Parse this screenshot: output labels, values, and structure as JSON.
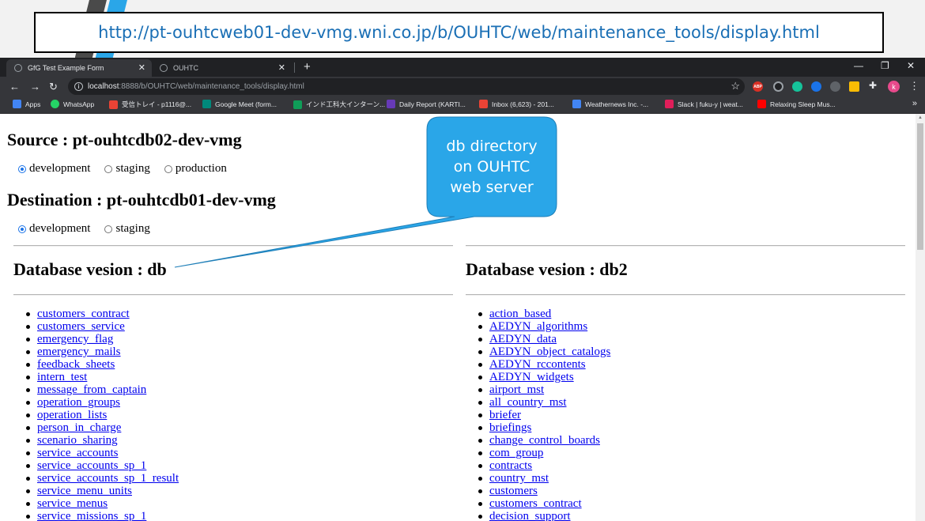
{
  "slide": {
    "url_caption": "http://pt-ouhtcweb01-dev-vmg.wni.co.jp/b/OUHTC/web/maintenance_tools/display.html",
    "callout_text": [
      "db directory",
      "on OUHTC",
      "web server"
    ]
  },
  "browser": {
    "tabs": [
      {
        "label": "GfG Test Example Form",
        "active": true
      },
      {
        "label": "OUHTC",
        "active": false
      }
    ],
    "address": {
      "host": "localhost",
      "path": ":8888/b/OUHTC/web/maintenance_tools/display.html"
    },
    "bookmarks": [
      {
        "label": "Apps",
        "icon": "apps-grid-icon",
        "color": "#4285f4"
      },
      {
        "label": "WhatsApp",
        "icon": "whatsapp-icon",
        "color": "#25d366"
      },
      {
        "label": "受信トレイ - p1116@...",
        "icon": "gmail-icon",
        "color": "#ea4335"
      },
      {
        "label": "Google Meet (form...",
        "icon": "meet-icon",
        "color": "#00897b"
      },
      {
        "label": "インド工科大インターン...",
        "icon": "sheets-plus-icon",
        "color": "#0f9d58"
      },
      {
        "label": "Daily Report (KARTI...",
        "icon": "forms-icon",
        "color": "#673ab7"
      },
      {
        "label": "Inbox (6,623) - 201...",
        "icon": "gmail-icon",
        "color": "#ea4335"
      },
      {
        "label": "Weathernews Inc. -...",
        "icon": "calendar-icon",
        "color": "#4285f4"
      },
      {
        "label": "Slack | fuku-y | weat...",
        "icon": "slack-icon",
        "color": "#e01e5a"
      },
      {
        "label": "Relaxing Sleep Mus...",
        "icon": "youtube-icon",
        "color": "#ff0000"
      }
    ],
    "extension_labels": {
      "abp": "ABP",
      "avatar": "k"
    }
  },
  "page": {
    "source_heading": "Source : pt-ouhtcdb02-dev-vmg",
    "source_options": [
      {
        "label": "development",
        "checked": true
      },
      {
        "label": "staging",
        "checked": false
      },
      {
        "label": "production",
        "checked": false
      }
    ],
    "destination_heading": "Destination : pt-ouhtcdb01-dev-vmg",
    "destination_options": [
      {
        "label": "development",
        "checked": true
      },
      {
        "label": "staging",
        "checked": false
      }
    ],
    "left_db": {
      "title": "Database vesion : db",
      "tables": [
        "customers_contract",
        "customers_service",
        "emergency_flag",
        "emergency_mails",
        "feedback_sheets",
        "intern_test",
        "message_from_captain",
        "operation_groups",
        "operation_lists",
        "person_in_charge",
        "scenario_sharing",
        "service_accounts",
        "service_accounts_sp_1",
        "service_accounts_sp_1_result",
        "service_menu_units",
        "service_menus",
        "service_missions_sp_1"
      ]
    },
    "right_db": {
      "title": "Database vesion : db2",
      "tables": [
        "action_based",
        "AEDYN_algorithms",
        "AEDYN_data",
        "AEDYN_object_catalogs",
        "AEDYN_rccontents",
        "AEDYN_widgets",
        "airport_mst",
        "all_country_mst",
        "briefer",
        "briefings",
        "change_control_boards",
        "com_group",
        "contracts",
        "country_mst",
        "customers",
        "customers_contract",
        "decision_support"
      ]
    }
  },
  "colors": {
    "callout": "#2aa6e8",
    "link": "#0000ee",
    "caption_text": "#1a6fb5"
  }
}
